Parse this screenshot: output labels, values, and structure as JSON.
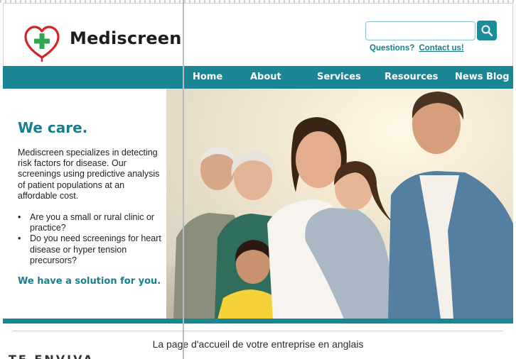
{
  "header": {
    "brand_name": "Mediscreen",
    "search_placeholder": "",
    "questions_label": "Questions?",
    "contact_link": "Contact us!"
  },
  "nav": {
    "items": [
      "Home",
      "About",
      "Services",
      "Resources",
      "News Blog"
    ]
  },
  "hero": {
    "title": "We care.",
    "description": "Mediscreen specializes in detecting risk factors for disease. Our screenings using predictive analysis of patient populations at an affordable cost.",
    "bullets": [
      "Are you a small or rural clinic or practice?",
      "Do you need screenings for heart disease or hyper tension precursors?"
    ],
    "cta": "We have a solution for you."
  },
  "caption": "La page d'accueil de votre entreprise en anglais",
  "cutoff_text": "TE ENVIVA",
  "colors": {
    "brand_teal": "#1a8593",
    "heart_red": "#d8222a",
    "cross_green": "#2fa84f"
  },
  "icons": {
    "logo": "heart-cross-icon",
    "search": "search-icon"
  }
}
